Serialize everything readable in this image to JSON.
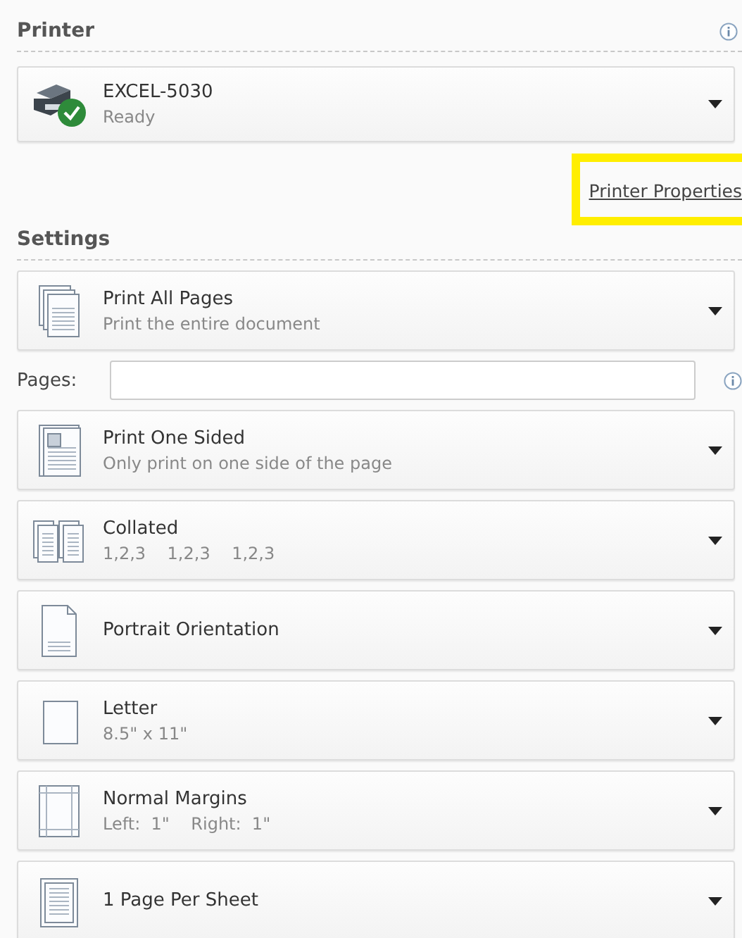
{
  "printer_section": {
    "heading": "Printer",
    "printer": {
      "name": "EXCEL-5030",
      "status": "Ready",
      "ready": true
    },
    "properties_link": {
      "label": "Printer Properties",
      "highlighted": true
    }
  },
  "settings_section": {
    "heading": "Settings",
    "dropdowns": [
      {
        "kind": "pages",
        "title": "Print All Pages",
        "subtitle": "Print the entire document"
      },
      {
        "kind": "pages_field",
        "label": "Pages:"
      },
      {
        "kind": "sided",
        "title": "Print One Sided",
        "subtitle": "Only print on one side of the page"
      },
      {
        "kind": "collated",
        "title": "Collated",
        "subtitle": "1,2,3    1,2,3    1,2,3"
      },
      {
        "kind": "portrait",
        "title": "Portrait Orientation"
      },
      {
        "kind": "letter",
        "title": "Letter",
        "subtitle": "8.5\" x 11\""
      },
      {
        "kind": "margins",
        "title": "Normal Margins",
        "subtitle": "Left:  1\"    Right:  1\""
      },
      {
        "kind": "per_sheet",
        "title": "1 Page Per Sheet"
      }
    ]
  }
}
